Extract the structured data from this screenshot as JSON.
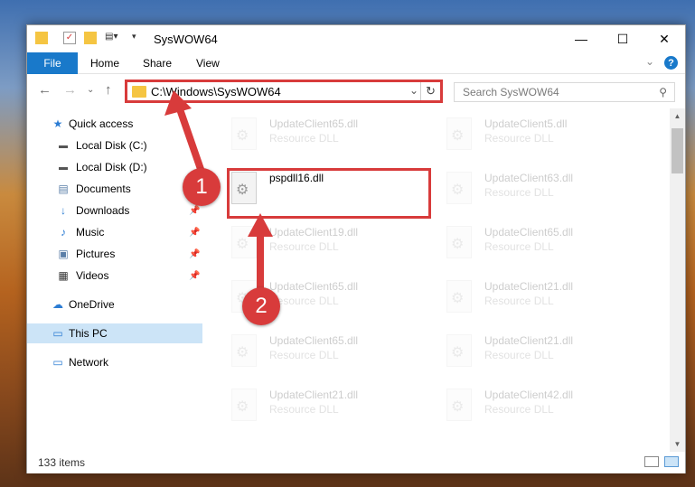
{
  "window": {
    "title": "SysWOW64"
  },
  "ribbon": {
    "file_tab": "File",
    "tabs": [
      "Home",
      "Share",
      "View"
    ]
  },
  "nav": {
    "address": "C:\\Windows\\SysWOW64",
    "search_placeholder": "Search SysWOW64"
  },
  "sidebar": {
    "items": [
      {
        "label": "Quick access",
        "icon": "star-icon"
      },
      {
        "label": "Local Disk (C:)",
        "icon": "drive-icon"
      },
      {
        "label": "Local Disk (D:)",
        "icon": "drive-icon"
      },
      {
        "label": "Documents",
        "icon": "documents-icon"
      },
      {
        "label": "Downloads",
        "icon": "download-icon"
      },
      {
        "label": "Music",
        "icon": "music-icon"
      },
      {
        "label": "Pictures",
        "icon": "pictures-icon"
      },
      {
        "label": "Videos",
        "icon": "videos-icon"
      },
      {
        "label": "OneDrive",
        "icon": "cloud-icon"
      },
      {
        "label": "This PC",
        "icon": "computer-icon"
      },
      {
        "label": "Network",
        "icon": "network-icon"
      }
    ]
  },
  "files": {
    "left": [
      {
        "name": "UpdateClient65.dll",
        "type": "Resource DLL"
      },
      {
        "name": "pspdll16.dll",
        "type": ""
      },
      {
        "name": "UpdateClient19.dll",
        "type": "Resource DLL"
      },
      {
        "name": "UpdateClient65.dll",
        "type": "Resource DLL"
      },
      {
        "name": "UpdateClient65.dll",
        "type": "Resource DLL"
      },
      {
        "name": "UpdateClient21.dll",
        "type": "Resource DLL"
      }
    ],
    "right": [
      {
        "name": "UpdateClient5.dll",
        "type": "Resource DLL"
      },
      {
        "name": "UpdateClient63.dll",
        "type": "Resource DLL"
      },
      {
        "name": "UpdateClient65.dll",
        "type": "Resource DLL"
      },
      {
        "name": "UpdateClient21.dll",
        "type": "Resource DLL"
      },
      {
        "name": "UpdateClient21.dll",
        "type": "Resource DLL"
      },
      {
        "name": "UpdateClient42.dll",
        "type": "Resource DLL"
      }
    ]
  },
  "status": {
    "item_count": "133 items"
  },
  "callouts": {
    "one": "1",
    "two": "2"
  },
  "colors": {
    "accent": "#1979ca",
    "annotation": "#d83b3b",
    "selection": "#cce4f7"
  }
}
